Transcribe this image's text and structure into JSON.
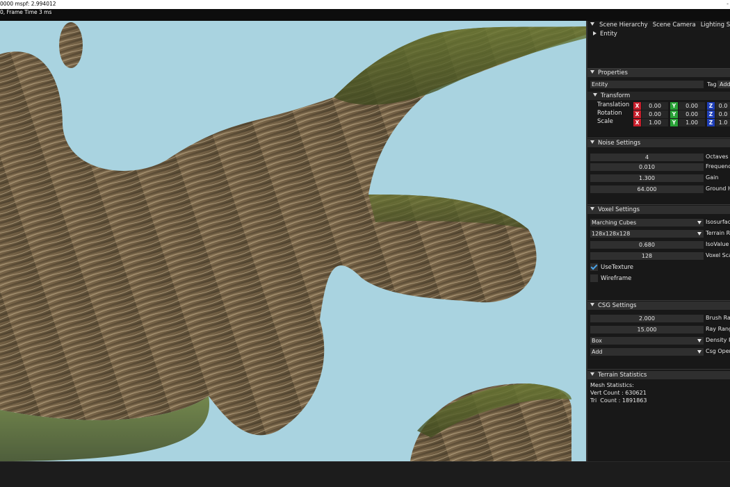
{
  "window": {
    "title": "0000  mspf: 2.994012",
    "frame_info": "0, Frame Time 3 ms",
    "close_glyph": "-"
  },
  "panel": {
    "tabs": [
      "Scene Hierarchy",
      "Scene Camera",
      "Lighting Setting"
    ],
    "hierarchy": {
      "entity": "Entity"
    },
    "properties": {
      "header": "Properties",
      "entity_name": "Entity",
      "tag_label": "Tag",
      "add_label": "Add"
    },
    "transform": {
      "header": "Transform",
      "rows": [
        {
          "label": "Translation",
          "x": "0.00",
          "y": "0.00",
          "z": "0.0"
        },
        {
          "label": "Rotation",
          "x": "0.00",
          "y": "0.00",
          "z": "0.0"
        },
        {
          "label": "Scale",
          "x": "1.00",
          "y": "1.00",
          "z": "1.0"
        }
      ],
      "axis_x": "X",
      "axis_y": "Y",
      "axis_z": "Z"
    },
    "noise": {
      "header": "Noise Settings",
      "fields": [
        {
          "value": "4",
          "label": "Octaves"
        },
        {
          "value": "0.010",
          "label": "Frequenc"
        },
        {
          "value": "1.300",
          "label": "Gain"
        },
        {
          "value": "64.000",
          "label": "Ground H"
        }
      ]
    },
    "voxel": {
      "header": "Voxel Settings",
      "isosurface": {
        "value": "Marching Cubes",
        "label": "Isosurfac"
      },
      "terrain_res": {
        "value": "128x128x128",
        "label": "Terrain Re"
      },
      "isovalue": {
        "value": "0.680",
        "label": "IsoValue"
      },
      "voxel_scale": {
        "value": "128",
        "label": "Voxel Sca"
      },
      "use_texture": {
        "label": "UseTexture",
        "checked": true
      },
      "wireframe": {
        "label": "Wireframe",
        "checked": false
      }
    },
    "csg": {
      "header": "CSG Settings",
      "brush_radius": {
        "value": "2.000",
        "label": "Brush Rad"
      },
      "ray_range": {
        "value": "15.000",
        "label": "Ray Range"
      },
      "density": {
        "value": "Box",
        "label": "Density P"
      },
      "csg_operation": {
        "value": "Add",
        "label": "Csg Opera"
      }
    },
    "stats": {
      "header": "Terrain Statistics",
      "mesh": "Mesh Statistics:",
      "vert": "Vert Count : 630621",
      "tri": "Tri  Count : 1891863"
    }
  },
  "colors": {
    "sky": "#a9d3e0",
    "terrain_rock": "#7d6a4c",
    "terrain_grass": "#5b6b2b",
    "check_accent": "#4aa3e8"
  }
}
